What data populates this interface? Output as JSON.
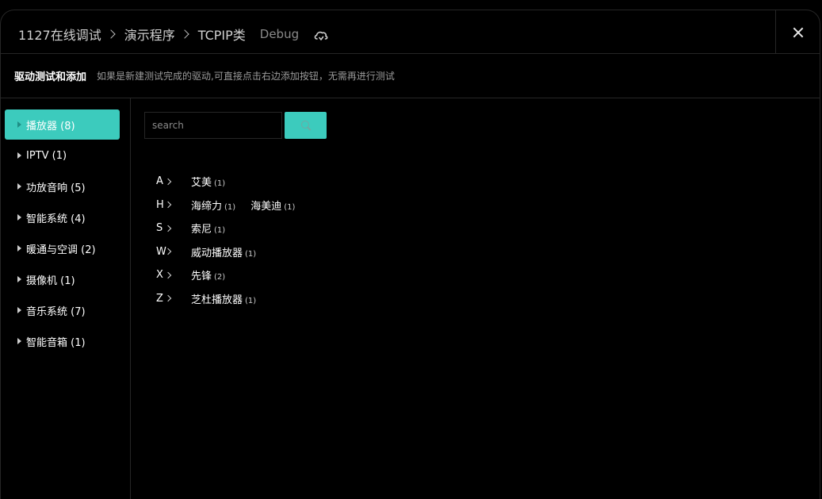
{
  "header": {
    "breadcrumbs": [
      "1127在线调试",
      "演示程序",
      "TCPIP类"
    ],
    "mode_label": "Debug"
  },
  "subheader": {
    "title": "驱动测试和添加",
    "description": "如果是新建测试完成的驱动,可直接点击右边添加按钮，无需再进行测试"
  },
  "sidebar": {
    "items": [
      {
        "label": "播放器 (8)",
        "active": true
      },
      {
        "label": "IPTV (1)"
      },
      {
        "label": "功放音响 (5)"
      },
      {
        "label": "智能系统 (4)"
      },
      {
        "label": "暖通与空调 (2)"
      },
      {
        "label": "摄像机 (1)"
      },
      {
        "label": "音乐系统 (7)"
      },
      {
        "label": "智能音箱 (1)"
      }
    ]
  },
  "search": {
    "placeholder": "search"
  },
  "groups": [
    {
      "letter": "A",
      "brands": [
        {
          "name": "艾美",
          "count": "(1)"
        }
      ]
    },
    {
      "letter": "H",
      "brands": [
        {
          "name": "海缔力",
          "count": "(1)"
        },
        {
          "name": "海美迪",
          "count": "(1)"
        }
      ]
    },
    {
      "letter": "S",
      "brands": [
        {
          "name": "索尼",
          "count": "(1)"
        }
      ]
    },
    {
      "letter": "W",
      "brands": [
        {
          "name": "威动播放器",
          "count": "(1)"
        }
      ]
    },
    {
      "letter": "X",
      "brands": [
        {
          "name": "先锋",
          "count": "(2)"
        }
      ]
    },
    {
      "letter": "Z",
      "brands": [
        {
          "name": "芝杜播放器",
          "count": "(1)"
        }
      ]
    }
  ],
  "colors": {
    "accent": "#3ccbbd",
    "border": "#262626",
    "background": "#000000"
  }
}
